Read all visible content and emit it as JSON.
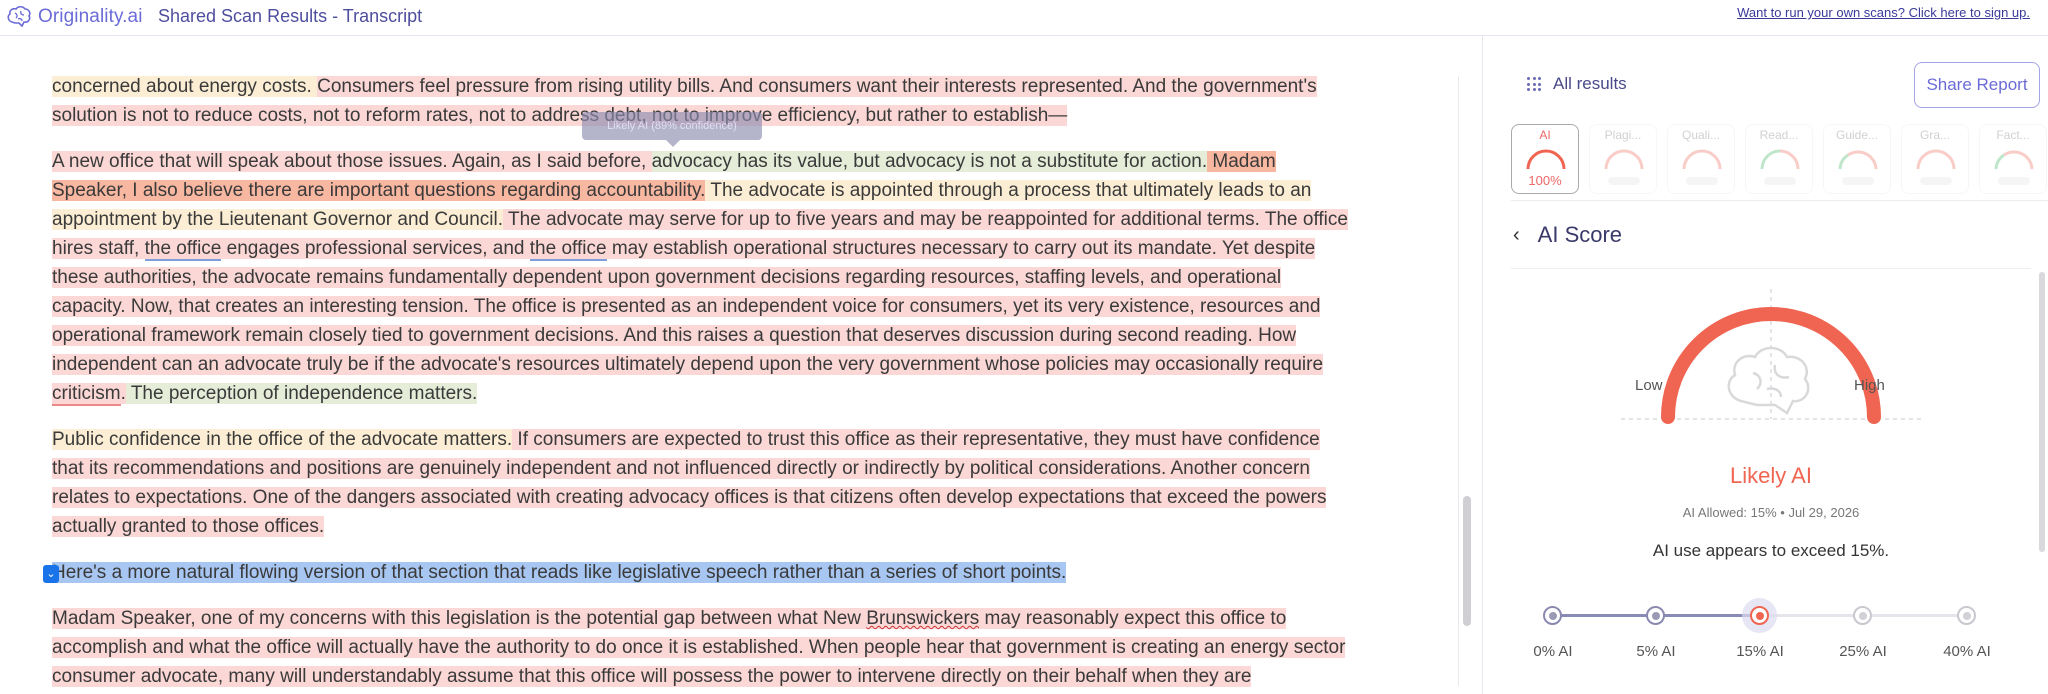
{
  "header": {
    "brand": "Originality.ai",
    "title": "Shared Scan Results - Transcript",
    "signup": "Want to run your own scans? Click here to sign up."
  },
  "tooltip": "Likely AI (89% confidence)",
  "document": {
    "p1": {
      "a": "concerned about energy costs. ",
      "b": "Consumers feel pressure from rising utility bills. And consumers want their interests represented. And the government's solution is not to reduce costs, not to reform rates, not to address debt, not to improve efficiency, but rather to establish—"
    },
    "p2": {
      "a": "A new office that will speak about those issues. Again, as I said before, ",
      "b": "advocacy has its value, but advocacy is not a substitute for action.",
      "c": " Madam Speaker, I also believe there are important questions regarding accountability.",
      "d": " The advocate is appointed through a process that ultimately leads to an appointment by the Lieutenant Governor and Council.",
      "e": " The advocate may serve for up to five years and may be reappointed for additional terms. The office hires staff, ",
      "f": "the office",
      "g": " engages professional services, and ",
      "h": "the office",
      "i": " may establish operational structures necessary to carry out its mandate. Yet despite these authorities, the advocate remains fundamentally dependent upon government decisions regarding resources, staffing levels, and operational capacity. Now, that creates an interesting tension. The office is presented as an independent voice for consumers, yet its very existence, resources and operational framework remain closely tied to government decisions. And this raises a question that deserves discussion during second reading. How independent can an advocate truly be if the advocate's resources ultimately depend upon the very government whose policies may occasionally require ",
      "j": "criticism",
      "k": ".",
      "l": " The perception of independence matters."
    },
    "p3": {
      "a": "Public confidence in the office of the advocate matters.",
      "b": " If consumers are expected to trust this office as their representative, they must have confidence that its recommendations and positions are genuinely independent and not influenced directly or indirectly by political considerations. Another concern relates to expectations. One of the dangers associated with creating advocacy offices is that citizens often develop expectations that exceed the powers actually granted to those offices."
    },
    "p4": "Here's a more natural flowing version of that section that reads like legislative speech rather than a series of short points.",
    "p5": {
      "a": "Madam Speaker, one of my concerns with this legislation is the potential gap between what New ",
      "b": "Brunswickers",
      "c": " may reasonably expect this office to accomplish and what the office will actually have the authority to do once it is established. When people hear that government is creating an energy sector consumer advocate, many will understandably assume that this office will possess the power to intervene directly on their behalf when they are"
    }
  },
  "panel": {
    "all_results": "All results",
    "share": "Share Report",
    "tiles": [
      {
        "label": "AI",
        "value": "100%"
      },
      {
        "label": "Plagi..."
      },
      {
        "label": "Quali..."
      },
      {
        "label": "Read..."
      },
      {
        "label": "Guide..."
      },
      {
        "label": "Gra..."
      },
      {
        "label": "Fact..."
      }
    ],
    "score_title": "AI Score",
    "low": "Low",
    "high": "High",
    "verdict": "Likely AI",
    "allowed": "AI Allowed: 15%  •  Jul 29, 2026",
    "summary": "AI use appears to exceed 15%.",
    "threshold_stops": [
      "0% AI",
      "5% AI",
      "15% AI",
      "25% AI",
      "40% AI"
    ],
    "selected_threshold": "15% AI"
  },
  "colors": {
    "accent": "#6b6bd8",
    "ai_red": "#f06551"
  }
}
